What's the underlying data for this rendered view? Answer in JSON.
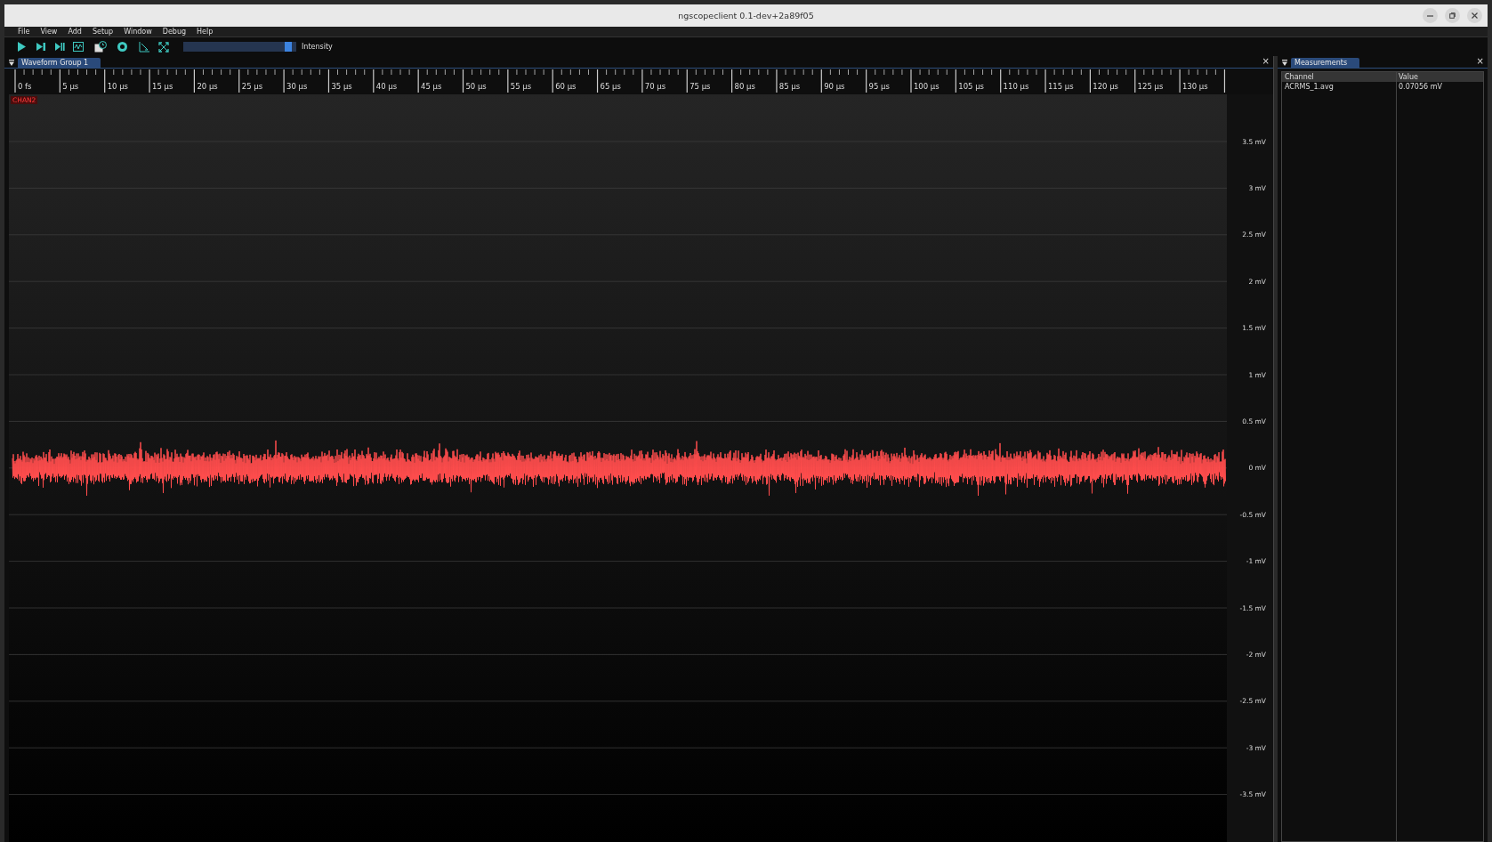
{
  "window": {
    "title": "ngscopeclient 0.1-dev+2a89f05"
  },
  "menu": [
    "File",
    "View",
    "Add",
    "Setup",
    "Window",
    "Debug",
    "Help"
  ],
  "toolbar": {
    "intensity": {
      "label": "Intensity",
      "level": 0.96
    }
  },
  "waveform_panel": {
    "tabs": [
      {
        "label": "Waveform Group 1",
        "selected": true
      }
    ],
    "close": "×",
    "time_ticks": [
      "0 fs",
      "5 µs",
      "10 µs",
      "15 µs",
      "20 µs",
      "25 µs",
      "30 µs",
      "35 µs",
      "40 µs",
      "45 µs",
      "50 µs",
      "55 µs",
      "60 µs",
      "65 µs",
      "70 µs",
      "75 µs",
      "80 µs",
      "85 µs",
      "90 µs",
      "95 µs",
      "100 µs",
      "105 µs",
      "110 µs",
      "115 µs",
      "120 µs",
      "125 µs",
      "130 µs"
    ],
    "channel": "CHAN2",
    "volt_ticks": [
      "3.5 mV",
      "3 mV",
      "2.5 mV",
      "2 mV",
      "1.5 mV",
      "1 mV",
      "0.5 mV",
      "0 mV",
      "-0.5 mV",
      "-1 mV",
      "-1.5 mV",
      "-2 mV",
      "-2.5 mV",
      "-3 mV",
      "-3.5 mV"
    ]
  },
  "measurements_panel": {
    "tabs": [
      {
        "label": "Measurements",
        "selected": true
      }
    ],
    "close": "×",
    "columns": [
      "Channel",
      "Value"
    ],
    "rows": [
      [
        "ACRMS_1.avg",
        "0.07056 mV"
      ]
    ]
  }
}
